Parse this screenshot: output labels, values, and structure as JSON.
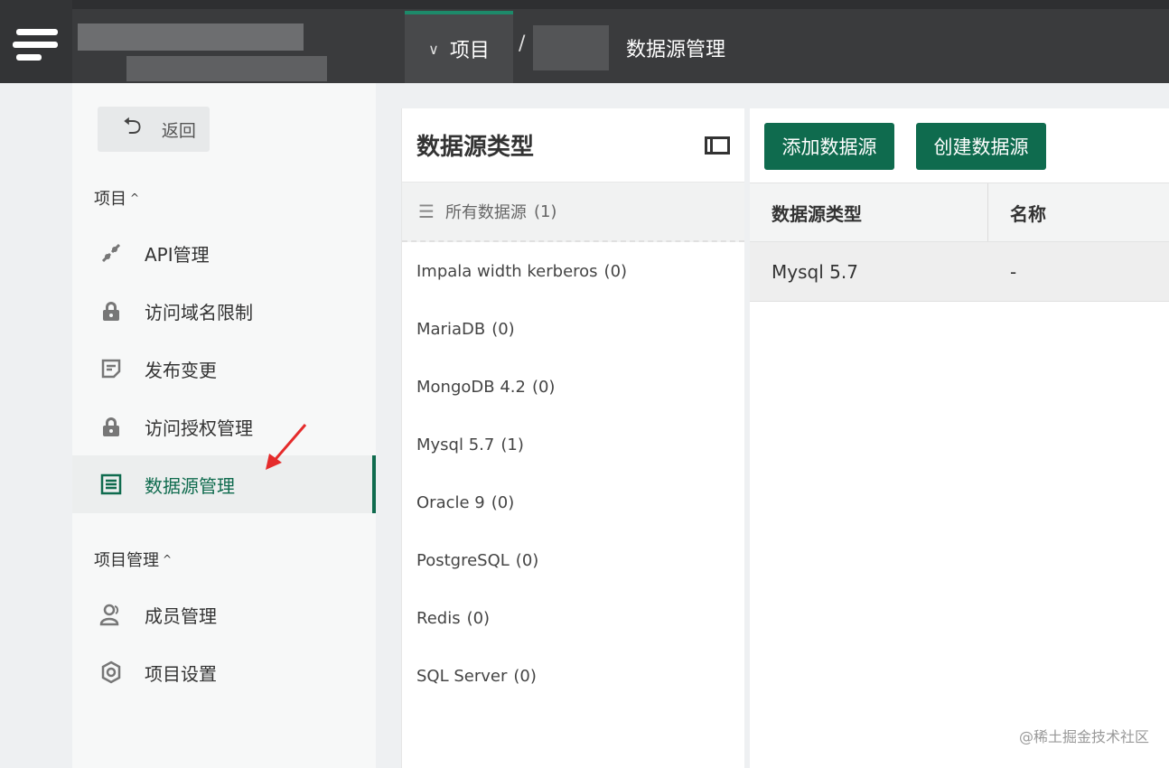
{
  "header": {
    "project_dropdown": "项目",
    "separator": "/",
    "current_page": "数据源管理"
  },
  "sidebar": {
    "back_label": "返回",
    "section1_title": "项目",
    "items": [
      {
        "label": "API管理",
        "icon": "api-icon"
      },
      {
        "label": "访问域名限制",
        "icon": "lock-icon"
      },
      {
        "label": "发布变更",
        "icon": "note-icon"
      },
      {
        "label": "访问授权管理",
        "icon": "lock-icon"
      },
      {
        "label": "数据源管理",
        "icon": "datasource-icon",
        "active": true
      }
    ],
    "section2_title": "项目管理",
    "items2": [
      {
        "label": "成员管理",
        "icon": "user-icon"
      },
      {
        "label": "项目设置",
        "icon": "gear-icon"
      }
    ]
  },
  "types_panel": {
    "title": "数据源类型",
    "all_label": "所有数据源",
    "all_count": "(1)",
    "types": [
      {
        "name": "Impala width kerberos",
        "count": "(0)"
      },
      {
        "name": "MariaDB",
        "count": "(0)"
      },
      {
        "name": "MongoDB 4.2",
        "count": "(0)"
      },
      {
        "name": "Mysql 5.7",
        "count": "(1)"
      },
      {
        "name": "Oracle 9",
        "count": "(0)"
      },
      {
        "name": "PostgreSQL",
        "count": "(0)"
      },
      {
        "name": "Redis",
        "count": "(0)"
      },
      {
        "name": "SQL Server",
        "count": "(0)"
      }
    ]
  },
  "toolbar": {
    "add_label": "添加数据源",
    "create_label": "创建数据源"
  },
  "table": {
    "columns": [
      "数据源类型",
      "名称"
    ],
    "rows": [
      [
        "Mysql 5.7",
        "-"
      ]
    ]
  },
  "watermark": "@稀土掘金技术社区",
  "colors": {
    "accent": "#0f6b4e",
    "topbar": "#3a3b3d"
  }
}
